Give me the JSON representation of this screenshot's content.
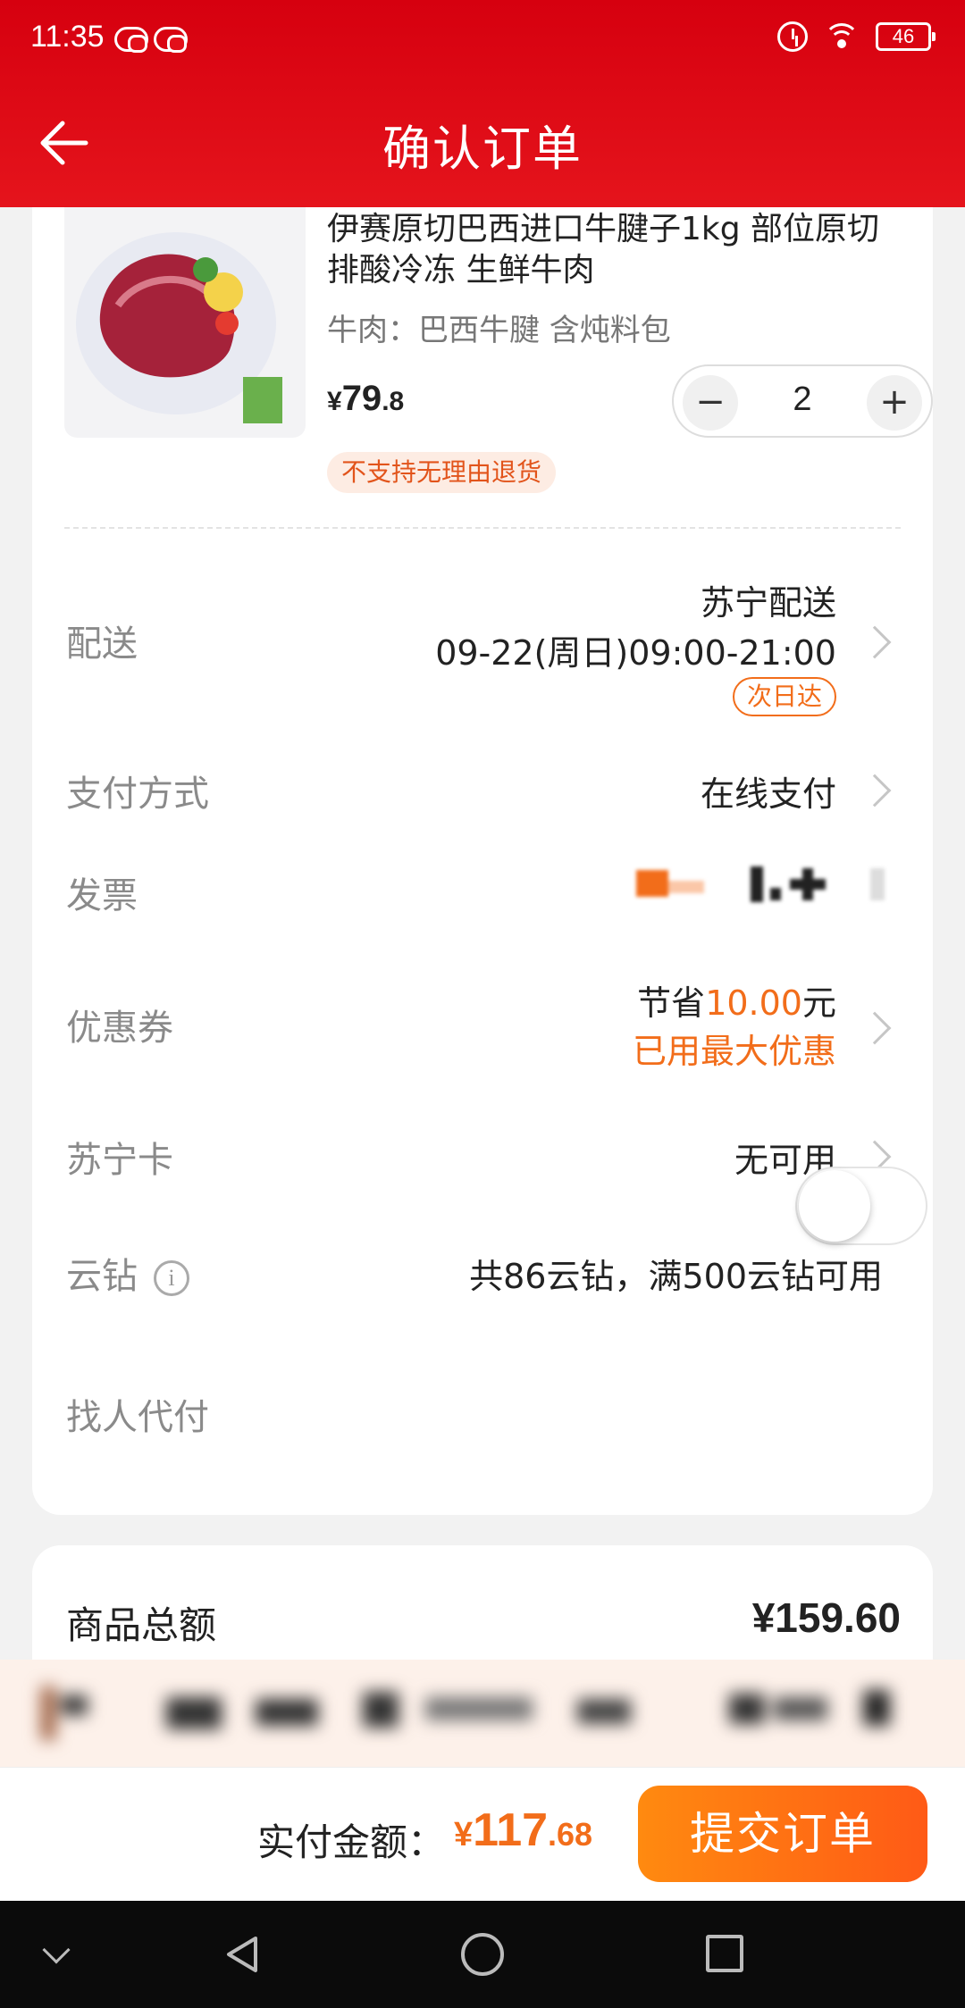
{
  "status_bar": {
    "time": "11:35",
    "battery": "46",
    "icons": [
      "wechat-icon",
      "wechat-icon",
      "alarm-icon",
      "wifi-icon",
      "battery-icon"
    ]
  },
  "header": {
    "title": "确认订单",
    "back_icon": "back-arrow-icon"
  },
  "product": {
    "name": "伊赛原切巴西进口牛腱子1kg 部位原切 排酸冷冻 生鲜牛肉",
    "spec": "牛肉：巴西牛腱 含炖料包",
    "price_symbol": "¥",
    "price_int": "79",
    "price_dec": ".8",
    "quantity": "2",
    "minus_label": "−",
    "plus_label": "+",
    "return_tag": "不支持无理由退货"
  },
  "rows": {
    "delivery": {
      "label": "配送",
      "carrier": "苏宁配送",
      "time": "09-22(周日)09:00-21:00",
      "badge": "次日达"
    },
    "payment": {
      "label": "支付方式",
      "value": "在线支付"
    },
    "invoice": {
      "label": "发票"
    },
    "coupon": {
      "label": "优惠券",
      "save_prefix": "节省",
      "save_amount": "10.00",
      "save_suffix": "元",
      "note": "已用最大优惠"
    },
    "suning_card": {
      "label": "苏宁卡",
      "value": "无可用"
    },
    "cloud_diamond": {
      "label": "云钻",
      "info_icon": "i",
      "value": "共86云钻，满500云钻可用"
    },
    "pay_for_me": {
      "label": "找人代付",
      "toggle_on": false
    }
  },
  "summary": {
    "label": "商品总额",
    "value": "¥159.60"
  },
  "bottom_bar": {
    "pay_label": "实付金额：",
    "pay_symbol": "¥",
    "pay_int": "117",
    "pay_dec": ".68",
    "submit_label": "提交订单"
  },
  "colors": {
    "header_red": "#e3101a",
    "accent_orange": "#f26d1a",
    "submit_gradient": [
      "#ff8a10",
      "#ff5a16"
    ]
  }
}
